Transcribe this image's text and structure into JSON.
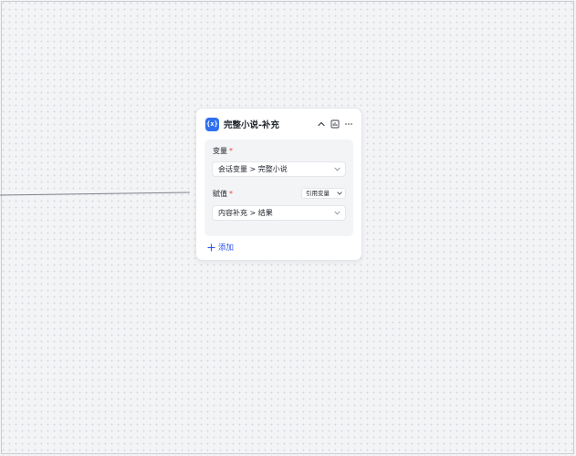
{
  "node": {
    "icon": "variable-assign-icon",
    "icon_glyph": "{x}",
    "title": "完整小说-补充",
    "accent_color": "#2f6ff0"
  },
  "variable_field": {
    "label": "变量",
    "required_mark": "*",
    "value": "会话变量 > 完整小说"
  },
  "assign_field": {
    "label": "赋值",
    "required_mark": "*",
    "mode": "引用变量",
    "value": "内容补充 > 结果"
  },
  "add": {
    "label": "添加"
  }
}
